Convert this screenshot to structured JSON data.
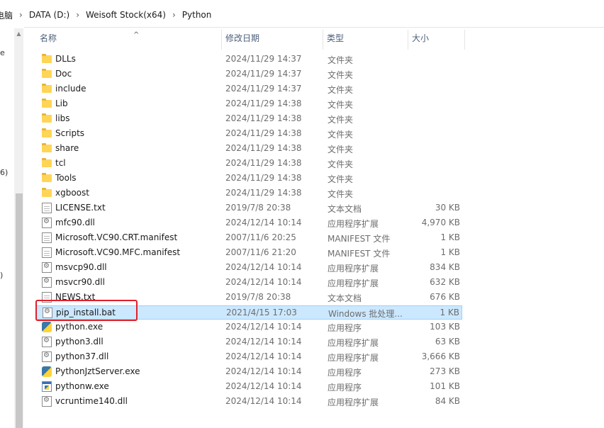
{
  "address": {
    "crumbs": [
      "电脑",
      "DATA (D:)",
      "Weisoft Stock(x64)",
      "Python"
    ],
    "separator": "›"
  },
  "nav_fragments": [
    "e",
    "6)",
    ")"
  ],
  "columns": {
    "name": "名称",
    "date": "修改日期",
    "type": "类型",
    "size": "大小"
  },
  "files": [
    {
      "name": "DLLs",
      "date": "2024/11/29 14:37",
      "type": "文件夹",
      "size": "",
      "icon": "folder-icon"
    },
    {
      "name": "Doc",
      "date": "2024/11/29 14:37",
      "type": "文件夹",
      "size": "",
      "icon": "folder-icon"
    },
    {
      "name": "include",
      "date": "2024/11/29 14:37",
      "type": "文件夹",
      "size": "",
      "icon": "folder-icon"
    },
    {
      "name": "Lib",
      "date": "2024/11/29 14:38",
      "type": "文件夹",
      "size": "",
      "icon": "folder-icon"
    },
    {
      "name": "libs",
      "date": "2024/11/29 14:38",
      "type": "文件夹",
      "size": "",
      "icon": "folder-icon"
    },
    {
      "name": "Scripts",
      "date": "2024/11/29 14:38",
      "type": "文件夹",
      "size": "",
      "icon": "folder-icon"
    },
    {
      "name": "share",
      "date": "2024/11/29 14:38",
      "type": "文件夹",
      "size": "",
      "icon": "folder-icon"
    },
    {
      "name": "tcl",
      "date": "2024/11/29 14:38",
      "type": "文件夹",
      "size": "",
      "icon": "folder-icon"
    },
    {
      "name": "Tools",
      "date": "2024/11/29 14:38",
      "type": "文件夹",
      "size": "",
      "icon": "folder-icon"
    },
    {
      "name": "xgboost",
      "date": "2024/11/29 14:38",
      "type": "文件夹",
      "size": "",
      "icon": "folder-icon"
    },
    {
      "name": "LICENSE.txt",
      "date": "2019/7/8 20:38",
      "type": "文本文档",
      "size": "30 KB",
      "icon": "text-file-icon"
    },
    {
      "name": "mfc90.dll",
      "date": "2024/12/14 10:14",
      "type": "应用程序扩展",
      "size": "4,970 KB",
      "icon": "dll-file-icon"
    },
    {
      "name": "Microsoft.VC90.CRT.manifest",
      "date": "2007/11/6 20:25",
      "type": "MANIFEST 文件",
      "size": "1 KB",
      "icon": "text-file-icon"
    },
    {
      "name": "Microsoft.VC90.MFC.manifest",
      "date": "2007/11/6 21:20",
      "type": "MANIFEST 文件",
      "size": "1 KB",
      "icon": "text-file-icon"
    },
    {
      "name": "msvcp90.dll",
      "date": "2024/12/14 10:14",
      "type": "应用程序扩展",
      "size": "834 KB",
      "icon": "dll-file-icon"
    },
    {
      "name": "msvcr90.dll",
      "date": "2024/12/14 10:14",
      "type": "应用程序扩展",
      "size": "632 KB",
      "icon": "dll-file-icon"
    },
    {
      "name": "NEWS.txt",
      "date": "2019/7/8 20:38",
      "type": "文本文档",
      "size": "676 KB",
      "icon": "text-file-icon"
    },
    {
      "name": "pip_install.bat",
      "date": "2021/4/15 17:03",
      "type": "Windows 批处理...",
      "size": "1 KB",
      "icon": "batch-file-icon",
      "selected": true
    },
    {
      "name": "python.exe",
      "date": "2024/12/14 10:14",
      "type": "应用程序",
      "size": "103 KB",
      "icon": "python-icon"
    },
    {
      "name": "python3.dll",
      "date": "2024/12/14 10:14",
      "type": "应用程序扩展",
      "size": "63 KB",
      "icon": "dll-file-icon"
    },
    {
      "name": "python37.dll",
      "date": "2024/12/14 10:14",
      "type": "应用程序扩展",
      "size": "3,666 KB",
      "icon": "dll-file-icon"
    },
    {
      "name": "PythonJztServer.exe",
      "date": "2024/12/14 10:14",
      "type": "应用程序",
      "size": "273 KB",
      "icon": "python-icon"
    },
    {
      "name": "pythonw.exe",
      "date": "2024/12/14 10:14",
      "type": "应用程序",
      "size": "101 KB",
      "icon": "exe-icon"
    },
    {
      "name": "vcruntime140.dll",
      "date": "2024/12/14 10:14",
      "type": "应用程序扩展",
      "size": "84 KB",
      "icon": "dll-file-icon"
    }
  ],
  "colors": {
    "selection_bg": "#cce8ff",
    "selection_border": "#99d1ff",
    "highlight_annotation": "#e0202a",
    "header_text": "#4c607a"
  }
}
